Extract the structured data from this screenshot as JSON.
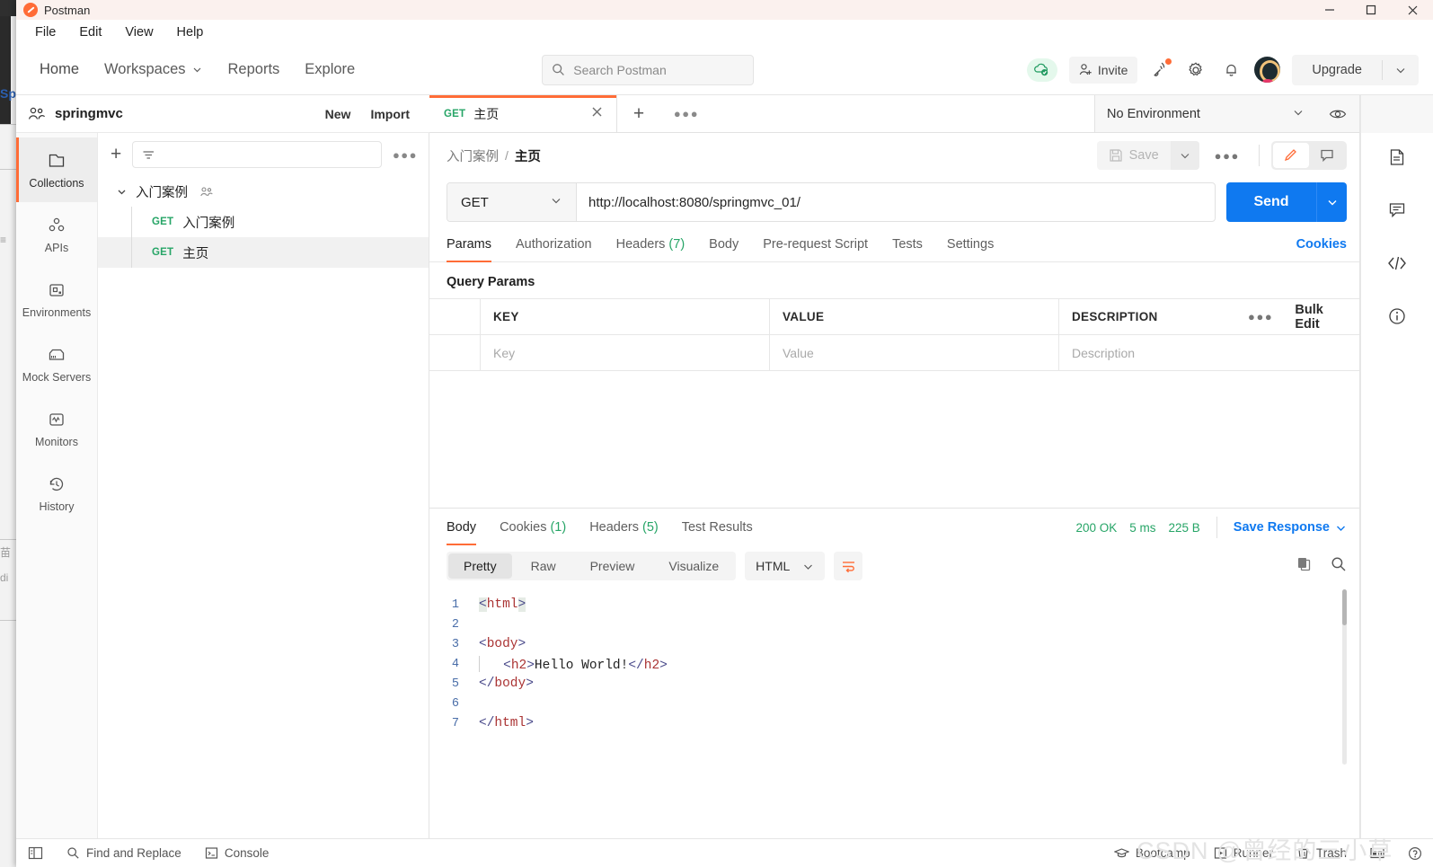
{
  "window": {
    "title": "Postman",
    "controls": {
      "minimize": "minimize-icon",
      "maximize": "maximize-icon",
      "close": "close-icon"
    }
  },
  "menubar": {
    "items": [
      "File",
      "Edit",
      "View",
      "Help"
    ]
  },
  "header": {
    "nav": [
      "Home",
      "Workspaces",
      "Reports",
      "Explore"
    ],
    "search": {
      "placeholder": "Search Postman",
      "icon": "search-icon"
    },
    "invite_label": "Invite",
    "upgrade_label": "Upgrade",
    "icons": [
      "cloud-check-icon",
      "invite-icon",
      "satellite-icon",
      "gear-icon",
      "bell-icon",
      "avatar-icon"
    ]
  },
  "workspace": {
    "name": "springmvc",
    "new_label": "New",
    "import_label": "Import"
  },
  "sidebar": {
    "items": [
      {
        "label": "Collections",
        "icon": "collections-icon",
        "active": true
      },
      {
        "label": "APIs",
        "icon": "apis-icon",
        "active": false
      },
      {
        "label": "Environments",
        "icon": "environments-icon",
        "active": false
      },
      {
        "label": "Mock Servers",
        "icon": "mock-servers-icon",
        "active": false
      },
      {
        "label": "Monitors",
        "icon": "monitors-icon",
        "active": false
      },
      {
        "label": "History",
        "icon": "history-icon",
        "active": false
      }
    ]
  },
  "collections": {
    "filter_placeholder": "",
    "root": {
      "name": "入门案例",
      "expanded": true
    },
    "requests": [
      {
        "method": "GET",
        "name": "入门案例",
        "selected": false
      },
      {
        "method": "GET",
        "name": "主页",
        "selected": true
      }
    ]
  },
  "tabs": {
    "open": [
      {
        "method": "GET",
        "name": "主页",
        "active": true
      }
    ],
    "environment": "No Environment"
  },
  "breadcrumb": {
    "parent": "入门案例",
    "separator": "/",
    "current": "主页"
  },
  "actions": {
    "save_label": "Save"
  },
  "request": {
    "method": "GET",
    "url": "http://localhost:8080/springmvc_01/",
    "send_label": "Send",
    "tabs": [
      {
        "label": "Params",
        "count": "",
        "active": true
      },
      {
        "label": "Authorization",
        "count": "",
        "active": false
      },
      {
        "label": "Headers",
        "count": "(7)",
        "active": false
      },
      {
        "label": "Body",
        "count": "",
        "active": false
      },
      {
        "label": "Pre-request Script",
        "count": "",
        "active": false
      },
      {
        "label": "Tests",
        "count": "",
        "active": false
      },
      {
        "label": "Settings",
        "count": "",
        "active": false
      }
    ],
    "cookies_link": "Cookies"
  },
  "query_params": {
    "title": "Query Params",
    "columns": [
      "KEY",
      "VALUE",
      "DESCRIPTION"
    ],
    "bulk_edit_label": "Bulk Edit",
    "rows": [
      {
        "key": "",
        "value": "",
        "description": ""
      }
    ],
    "placeholders": {
      "key": "Key",
      "value": "Value",
      "description": "Description"
    }
  },
  "response": {
    "tabs": [
      {
        "label": "Body",
        "count": "",
        "active": true
      },
      {
        "label": "Cookies",
        "count": "(1)",
        "active": false
      },
      {
        "label": "Headers",
        "count": "(5)",
        "active": false
      },
      {
        "label": "Test Results",
        "count": "",
        "active": false
      }
    ],
    "status": "200 OK",
    "time": "5 ms",
    "size": "225 B",
    "save_response_label": "Save Response",
    "view_modes": [
      "Pretty",
      "Raw",
      "Preview",
      "Visualize"
    ],
    "active_view": "Pretty",
    "format": "HTML",
    "body_lines": [
      {
        "n": "1",
        "text": "<html>"
      },
      {
        "n": "2",
        "text": ""
      },
      {
        "n": "3",
        "text": "<body>"
      },
      {
        "n": "4",
        "text": "    <h2>Hello World!</h2>"
      },
      {
        "n": "5",
        "text": "</body>"
      },
      {
        "n": "6",
        "text": ""
      },
      {
        "n": "7",
        "text": "</html>"
      }
    ]
  },
  "right_rail": {
    "icons": [
      "documentation-icon",
      "comment-icon",
      "code-icon",
      "info-icon"
    ]
  },
  "status_bar": {
    "left": [
      {
        "label": "",
        "icon": "sidebar-toggle-icon"
      },
      {
        "label": "Find and Replace",
        "icon": "search-icon"
      },
      {
        "label": "Console",
        "icon": "console-icon"
      }
    ],
    "right": [
      {
        "label": "Bootcamp",
        "icon": "bootcamp-icon"
      },
      {
        "label": "Runner",
        "icon": "runner-icon"
      },
      {
        "label": "Trash",
        "icon": "trash-icon"
      },
      {
        "label": "",
        "icon": "layout-icon"
      },
      {
        "label": "",
        "icon": "help-icon"
      }
    ]
  },
  "watermark": "CSDN @曾经的三小草",
  "colors": {
    "accent": "#ff6c37",
    "primary": "#0f79f0",
    "success": "#27a567"
  }
}
